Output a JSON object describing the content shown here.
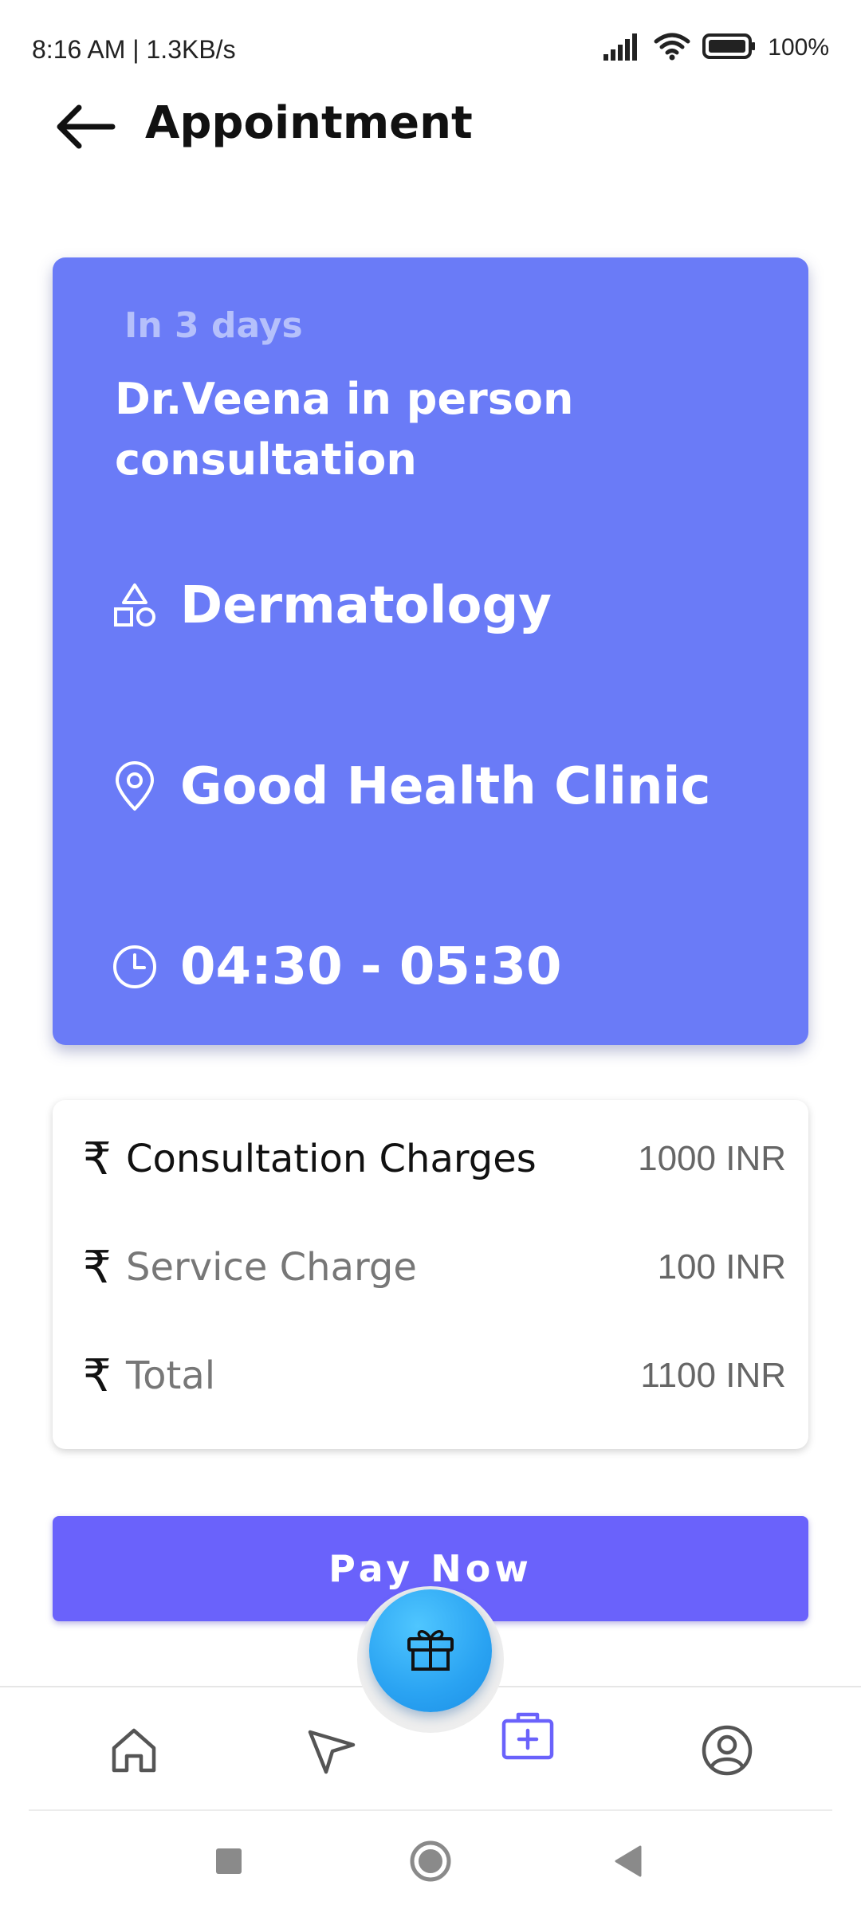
{
  "status_bar": {
    "time": "8:16 AM | 1.3KB/s",
    "battery": "100%"
  },
  "header": {
    "title": "Appointment"
  },
  "appointment": {
    "when": "In 3 days",
    "title": "Dr.Veena in person consultation",
    "department": "Dermatology",
    "clinic": "Good Health Clinic",
    "time": "04:30 - 05:30",
    "accent": "#6a7bf7"
  },
  "charges": {
    "currency_symbol": "₹",
    "items": [
      {
        "label": "Consultation Charges",
        "amount": "1000 INR"
      },
      {
        "label": "Service Charge",
        "amount": "100 INR"
      },
      {
        "label": "Total",
        "amount": "1100 INR"
      }
    ]
  },
  "pay_button": {
    "label": "Pay Now",
    "color": "#6a62fb"
  },
  "bottom_nav": {
    "items": [
      {
        "icon": "home-icon"
      },
      {
        "icon": "navigation-arrow-icon"
      },
      {
        "icon": "medical-kit-icon",
        "active": true
      },
      {
        "icon": "profile-icon"
      }
    ],
    "fab_icon": "gift-icon",
    "active_color": "#6a62fb"
  }
}
